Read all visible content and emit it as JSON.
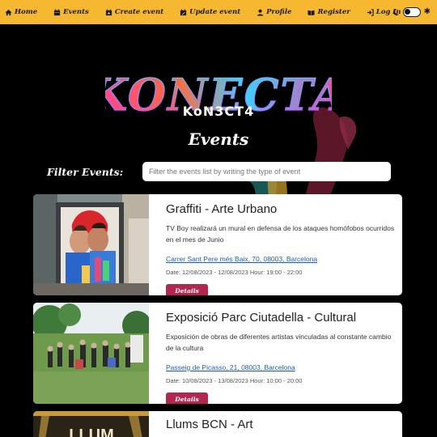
{
  "nav": {
    "items": [
      {
        "label": "Home",
        "icon": "home-icon"
      },
      {
        "label": "Events",
        "icon": "calendar-icon"
      },
      {
        "label": "Create event",
        "icon": "calendar-plus-icon"
      },
      {
        "label": "Update event",
        "icon": "calendar-edit-icon"
      },
      {
        "label": "Profile",
        "icon": "user-icon"
      },
      {
        "label": "Register",
        "icon": "book-icon"
      },
      {
        "label": "Log In",
        "icon": "login-icon"
      }
    ],
    "theme_toggle": {
      "moon_icon": "moon-icon",
      "sun_icon": "sun-icon",
      "state": "dark"
    }
  },
  "hero": {
    "logo_text": "KONECTA",
    "subtitle": "KoN3CT4",
    "page_title": "Events"
  },
  "filter": {
    "label": "Filter Events:",
    "placeholder": "Filter the events list by writing the type of event"
  },
  "events": [
    {
      "title": "Graffiti - Arte Urbano",
      "description": "TV Boy realizará un mural en defensa de los ataques homófobos ocurridos en el mes de Junio",
      "address": "Carrer Sant Pere més Baix, 70, 08003, Barcelona",
      "date": "Date: 12/08/2023 - 12/08/2023 Hour: 19:00 - 22:00",
      "button": "Details"
    },
    {
      "title": "Exposició Parc Ciutadella - Cultural",
      "description": "Exposición de obras de diferentes artistas vinculadas al constante cambio de la cultura",
      "address": "Passeig de Picasso, 21, 08003, Barcelona",
      "date": "Date: 10/08/2023 - 13/08/2023 Hour: 10:00 - 20:00",
      "button": "Details"
    },
    {
      "title": "Llums BCN - Art",
      "image_text": "LLUM"
    }
  ],
  "colors": {
    "nav_bg": "#f5b830",
    "button": "#b32650",
    "link": "#1a5fb4",
    "page_bg": "#000000"
  }
}
